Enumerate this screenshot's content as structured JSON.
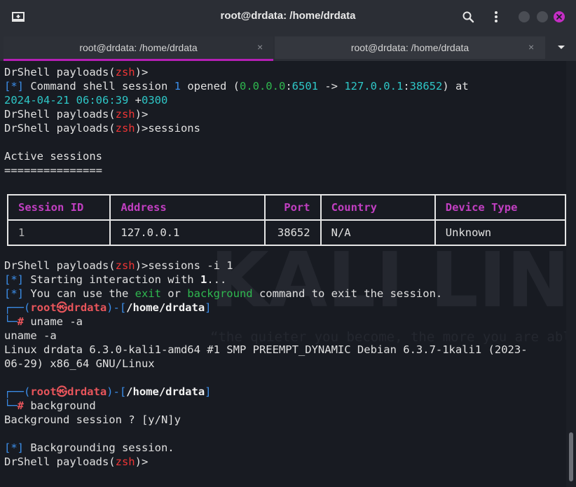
{
  "window": {
    "title": "root@drdata: /home/drdata"
  },
  "tabs": [
    {
      "label": "root@drdata: /home/drdata",
      "active": true
    },
    {
      "label": "root@drdata: /home/drdata",
      "active": false
    }
  ],
  "tab_close_glyph": "×",
  "colors": {
    "accent": "#b51fb5",
    "close_button": "#c42ec4",
    "red": "#ef3535",
    "blue": "#3b8eea",
    "cyan": "#2ec7c7",
    "green": "#2fb84f"
  },
  "icons": [
    "new-tab-icon",
    "search-icon",
    "kebab-menu-icon",
    "tab-dropdown-icon"
  ],
  "terminal": {
    "prompt_drshell": "DrShell payloads(",
    "prompt_zsh": "zsh",
    "prompt_close": ")>",
    "star_tag": "[*]",
    "line2_a": " Command shell session ",
    "line2_num": "1",
    "line2_b": " opened (",
    "line2_src_ip": "0.0.0.0",
    "colon": ":",
    "line2_src_port": "6501",
    "line2_arrow": " -> ",
    "line2_dst_ip": "127.0.0.1",
    "line2_dst_port": "38652",
    "line2_c": ") at",
    "line3_date": "2024-04-21",
    "line3_time": "06:06:39",
    "line3_tz_sign": " +",
    "line3_tz": "0300",
    "cmd_sessions": "sessions",
    "active_sessions": "Active sessions",
    "underline": "===============",
    "table": {
      "headers": [
        "Session ID",
        "Address",
        "Port",
        "Country",
        "Device Type"
      ],
      "rows": [
        [
          "1",
          "127.0.0.1",
          "38652",
          "N/A",
          "Unknown"
        ]
      ]
    },
    "cmd_sessions_i": "sessions -i 1",
    "starting_a": " Starting interaction with ",
    "starting_num": "1",
    "starting_b": "...",
    "can_use_a": " You can use the ",
    "exit_word": "exit",
    "or_word": " or ",
    "background_word": "background",
    "can_use_b": " command to exit the session.",
    "kali_corner_top": "┌──(",
    "kali_user": "root",
    "kali_skull": "㉿",
    "kali_host": "drdata",
    "kali_mid": ")-[",
    "kali_path": "/home/drdata",
    "kali_end": "]",
    "kali_corner_bottom": "└─",
    "kali_hash": "#",
    "cmd_uname": " uname -a",
    "echo_uname": "uname -a",
    "uname_out_1": "Linux drdata 6.3.0-kali1-amd64 #1 SMP PREEMPT_DYNAMIC Debian 6.3.7-1kali1 (2023-",
    "uname_out_2": "06-29) x86_64 GNU/Linux",
    "cmd_background": " background",
    "bg_question": "Background session ? [y/N]y",
    "backgrounding": " Backgrounding session."
  },
  "watermark": {
    "text": "KALI LINUX",
    "quote": "“the quieter you become, the more you are able to hear”"
  }
}
